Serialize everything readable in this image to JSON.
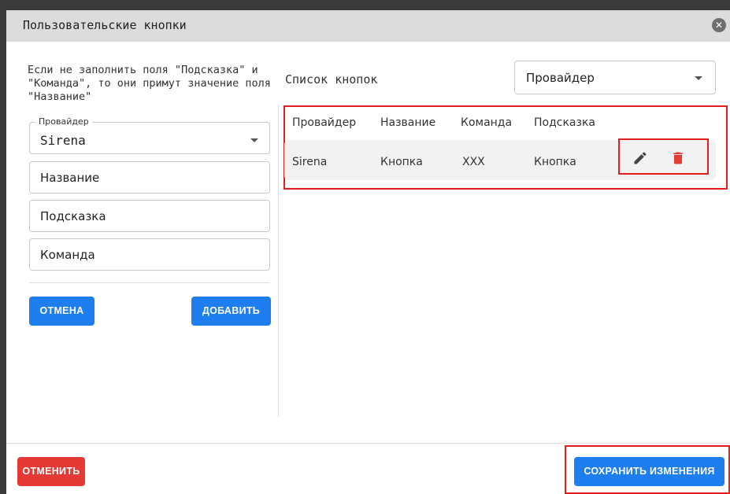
{
  "dialog": {
    "title": "Пользовательские кнопки"
  },
  "form": {
    "hint": "Если не заполнить поля \"Подсказка\" и \"Команда\", то они примут значение поля \"Название\"",
    "provider_label": "Провайдер",
    "provider_value": "Sirena",
    "name_placeholder": "Название",
    "hint_placeholder": "Подсказка",
    "command_placeholder": "Команда",
    "cancel_label": "ОТМЕНА",
    "add_label": "ДОБАВИТЬ"
  },
  "list": {
    "title": "Список кнопок",
    "provider_filter": "Провайдер",
    "columns": [
      "Провайдер",
      "Название",
      "Команда",
      "Подсказка"
    ],
    "rows": [
      [
        "Sirena",
        "Кнопка",
        "XXX",
        "Кнопка"
      ]
    ]
  },
  "footer": {
    "cancel_label": "ОТМЕНИТЬ",
    "save_label": "СОХРАНИТЬ ИЗМЕНЕНИЯ"
  },
  "icons": {
    "close": "close-icon",
    "edit": "pencil-icon",
    "delete": "trash-icon",
    "dropdown": "caret-down-icon"
  },
  "colors": {
    "primary": "#1e7ef0",
    "danger": "#e53935",
    "highlight_frame": "#e02020",
    "titlebar": "#dcdcdc"
  }
}
